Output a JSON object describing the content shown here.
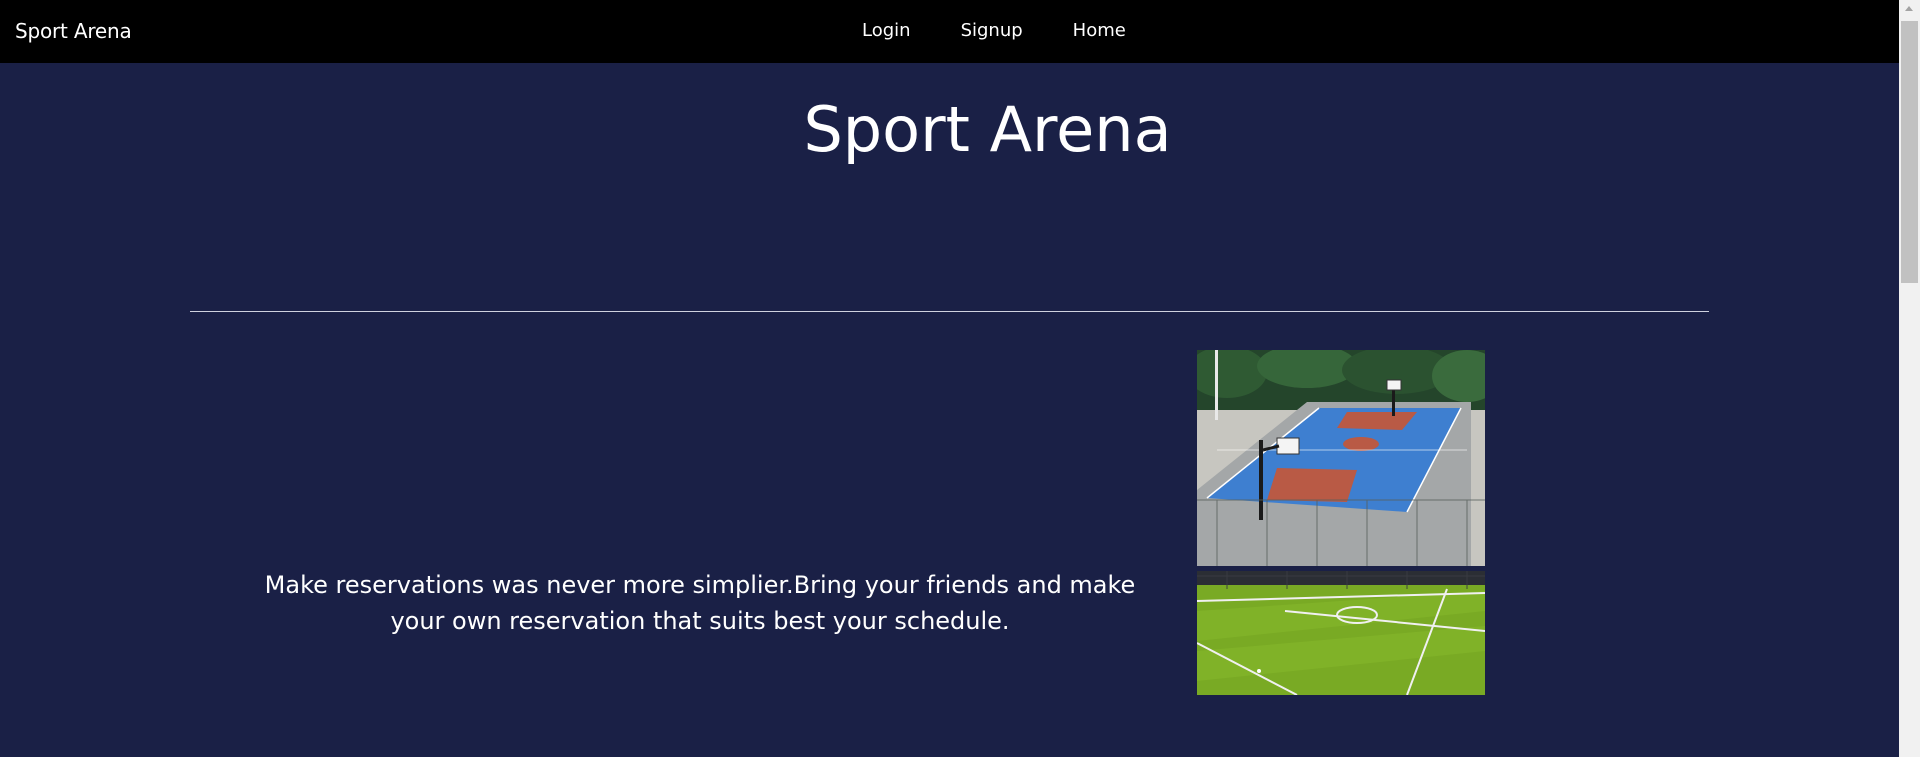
{
  "navbar": {
    "brand": "Sport Arena",
    "links": [
      {
        "label": "Login"
      },
      {
        "label": "Signup"
      },
      {
        "label": "Home"
      }
    ]
  },
  "hero": {
    "title": "Sport Arena",
    "tagline": "Make reservations was never more simplier.Bring your friends and make your own reservation that suits best your schedule."
  },
  "colors": {
    "navbar_bg": "#000000",
    "page_bg": "#1a2046",
    "text": "#ffffff",
    "divider": "#cfd2df"
  },
  "images": [
    {
      "name": "basketball-court-photo"
    },
    {
      "name": "football-field-photo"
    }
  ]
}
